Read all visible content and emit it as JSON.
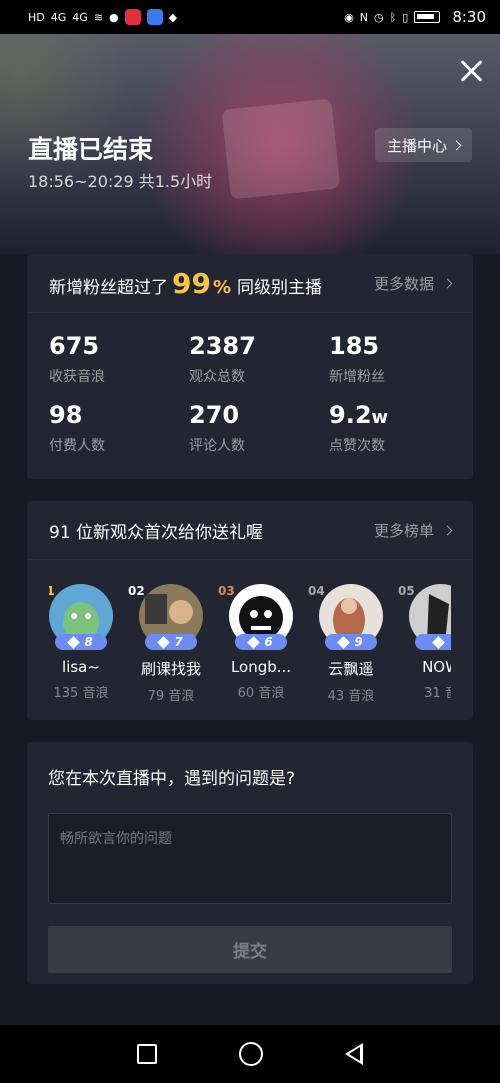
{
  "status_bar": {
    "time": "8:30",
    "signal_1": "4G",
    "signal_2": "4G",
    "colors": {
      "bg": "#000000"
    }
  },
  "hero": {
    "title": "直播已结束",
    "time_range": "18:56~20:29 共1.5小时",
    "anchor_center_label": "主播中心"
  },
  "stats": {
    "headline_prefix": "新增粉丝超过了",
    "headline_percent": "99",
    "headline_percent_sign": "%",
    "headline_suffix": "同级别主播",
    "more_label": "更多数据",
    "items": [
      {
        "value": "675",
        "unit": "",
        "label": "收获音浪"
      },
      {
        "value": "2387",
        "unit": "",
        "label": "观众总数"
      },
      {
        "value": "185",
        "unit": "",
        "label": "新增粉丝"
      },
      {
        "value": "98",
        "unit": "",
        "label": "付费人数"
      },
      {
        "value": "270",
        "unit": "",
        "label": "评论人数"
      },
      {
        "value": "9.2",
        "unit": "w",
        "label": "点赞次数"
      }
    ]
  },
  "gifts": {
    "headline": "91 位新观众首次给你送礼喔",
    "more_label": "更多榜单",
    "viewers": [
      {
        "rank": "01",
        "level": "8",
        "name": "lisa~",
        "score": "135 音浪"
      },
      {
        "rank": "02",
        "level": "7",
        "name": "刷课找我",
        "score": "79 音浪"
      },
      {
        "rank": "03",
        "level": "6",
        "name": "Longb...",
        "score": "60 音浪"
      },
      {
        "rank": "04",
        "level": "9",
        "name": "云飘遥",
        "score": "43 音浪"
      },
      {
        "rank": "05",
        "level": "",
        "name": "NOW",
        "score": "31 音"
      }
    ]
  },
  "feedback": {
    "question": "您在本次直播中，遇到的问题是?",
    "placeholder": "畅所欲言你的问题",
    "submit_label": "提交"
  },
  "colors": {
    "accent": "#f6c344",
    "level_badge": "#6b8cf0",
    "card_bg": "#232532",
    "page_bg": "#161823"
  }
}
